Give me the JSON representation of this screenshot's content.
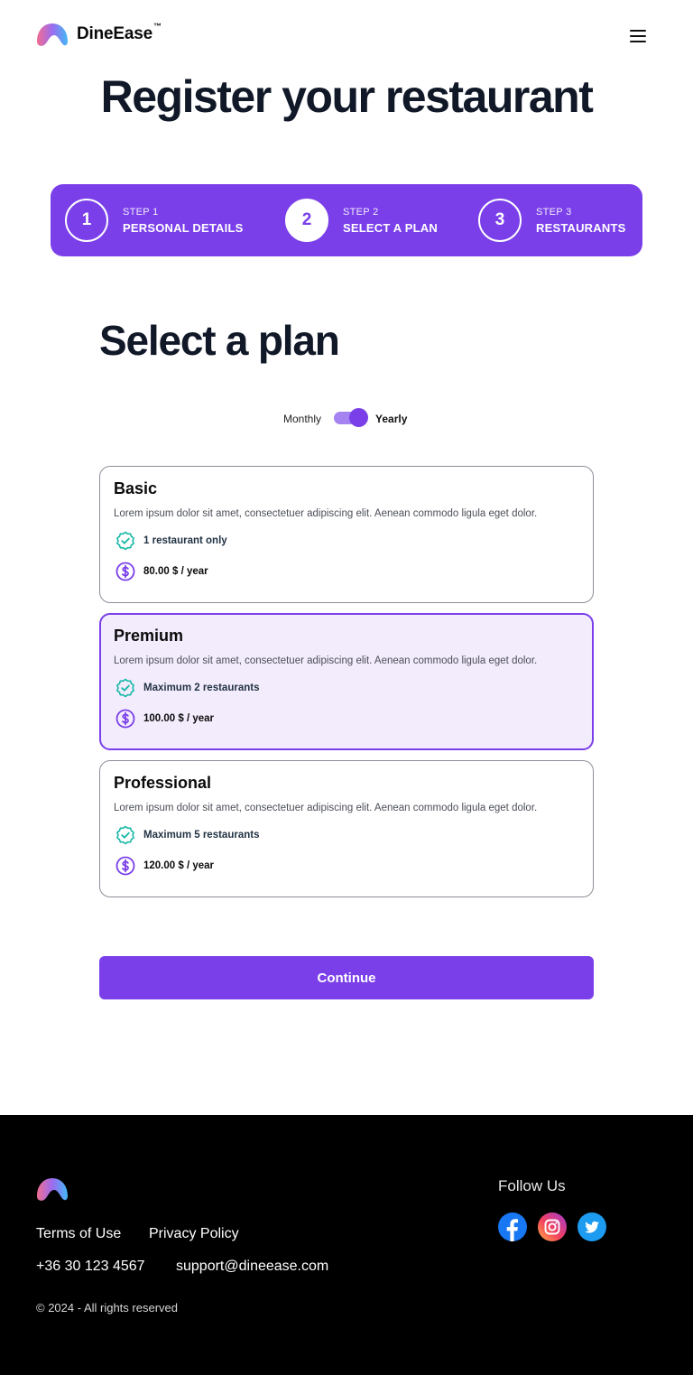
{
  "header": {
    "brand": "DineEase",
    "brand_mark": "™",
    "menu_icon": "hamburger-menu-icon"
  },
  "page_title": "Register your restaurant",
  "stepper": {
    "steps": [
      {
        "number": "1",
        "step_label": "STEP 1",
        "title": "PERSONAL DETAILS",
        "state": "completed"
      },
      {
        "number": "2",
        "step_label": "STEP 2",
        "title": "SELECT A PLAN",
        "state": "active"
      },
      {
        "number": "3",
        "step_label": "STEP 3",
        "title": "RESTAURANTS",
        "state": "upcoming"
      }
    ]
  },
  "plans_section": {
    "title": "Select a plan",
    "billing_toggle": {
      "left_label": "Monthly",
      "right_label": "Yearly",
      "selected": "Yearly"
    },
    "plans": [
      {
        "name": "Basic",
        "description": "Lorem ipsum dolor sit amet, consectetuer adipiscing elit. Aenean commodo ligula eget dolor.",
        "feature": "1 restaurant only",
        "price": "80.00 $ / year",
        "selected": false
      },
      {
        "name": "Premium",
        "description": "Lorem ipsum dolor sit amet, consectetuer adipiscing elit. Aenean commodo ligula eget dolor.",
        "feature": "Maximum 2 restaurants",
        "price": "100.00 $ / year",
        "selected": true
      },
      {
        "name": "Professional",
        "description": "Lorem ipsum dolor sit amet, consectetuer adipiscing elit. Aenean commodo ligula eget dolor.",
        "feature": "Maximum 5 restaurants",
        "price": "120.00 $ / year",
        "selected": false
      }
    ],
    "continue_label": "Continue"
  },
  "footer": {
    "links": {
      "terms": "Terms of Use",
      "privacy": "Privacy Policy",
      "phone": "+36 30 123 4567",
      "email": "support@dineease.com"
    },
    "copyright": "© 2024 - All rights reserved",
    "follow_label": "Follow Us",
    "social_icons": [
      "facebook-icon",
      "instagram-icon",
      "twitter-icon"
    ]
  },
  "colors": {
    "accent": "#7a3fe9",
    "accent_light": "#f3ecfd",
    "toggle_track": "#a583f0",
    "check_icon": "#14b8a6",
    "footer_bg": "#000000",
    "facebook": "#1877f2",
    "twitter": "#1d9bf0"
  }
}
